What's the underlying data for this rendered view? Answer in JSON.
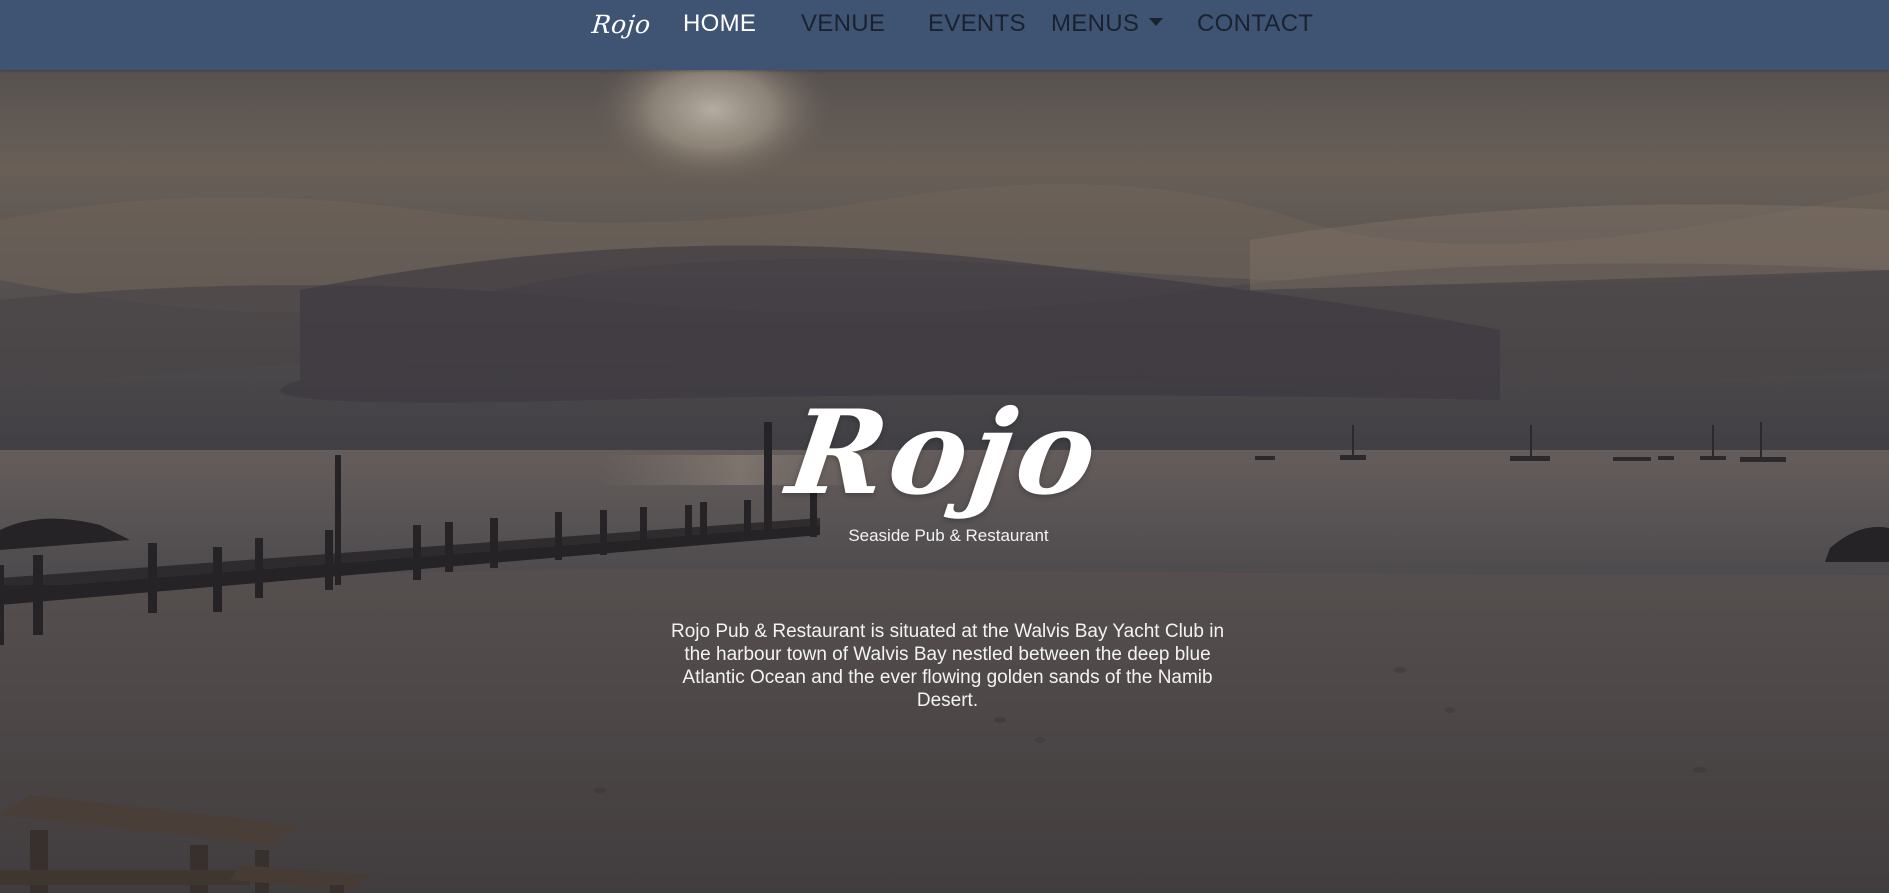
{
  "nav": {
    "brand": "Rojo",
    "items": [
      {
        "label": "HOME"
      },
      {
        "label": "VENUE"
      },
      {
        "label": "EVENTS"
      },
      {
        "label": "MENUS"
      },
      {
        "label": "CONTACT"
      }
    ]
  },
  "hero": {
    "title": "Rojo",
    "subtitle": "Seaside Pub & Restaurant",
    "description": "Rojo Pub & Restaurant is situated at the Walvis Bay Yacht Club in the harbour town of Walvis Bay nestled between the deep blue Atlantic Ocean and the ever flowing golden sands of the Namib Desert."
  },
  "colors": {
    "nav_bg": "#3f5473",
    "nav_active": "#ffffff",
    "nav_inactive": "#1a2230"
  },
  "icons": {
    "menus_dropdown": "caret-down-icon"
  }
}
